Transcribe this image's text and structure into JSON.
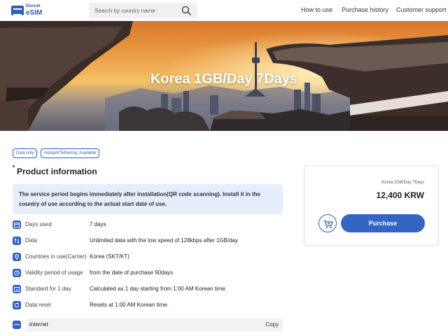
{
  "header": {
    "logo_small": "Doorak",
    "logo_big": "eSIM",
    "search_placeholder": "Search by country name",
    "nav": [
      "How to use",
      "Purchase history",
      "Customer support"
    ]
  },
  "hero": {
    "title": "Korea 1GB/Day 7Days"
  },
  "tags": [
    "Data only",
    "Hotspot/Tethering: Available"
  ],
  "product": {
    "section_title": "Product information",
    "notice": "The service period begins immediately after installation(QR code scanning). Install it in the country of use according to the actual start date of use.",
    "rows": [
      {
        "label": "Days used",
        "value": "7 days",
        "icon": "calendar-icon"
      },
      {
        "label": "Data",
        "value": "Unlimited data with the low speed of 128kbps after 1GB/day",
        "icon": "data-arrows-icon"
      },
      {
        "label": "Countries in use(Carrier)",
        "value": "Korea (SKT/KT)",
        "icon": "location-pin-icon"
      },
      {
        "label": "Validity period of usage",
        "value": "from the date of purchase 90days",
        "icon": "clock-icon"
      },
      {
        "label": "Standard for 1 day",
        "value": "Calculated as 1 day starting from 1:00 AM Korean time.",
        "icon": "calendar-day-icon"
      },
      {
        "label": "Data reset",
        "value": "Resets at 1:00 AM Korean time.",
        "icon": "refresh-icon"
      }
    ],
    "apn": {
      "icon_text": "APN",
      "value": "internet",
      "copy_label": "Copy"
    }
  },
  "purchase": {
    "product_name": "Korea 1GB/Day 7Days",
    "price": "12,400 KRW",
    "button_label": "Purchase"
  },
  "colors": {
    "accent": "#2f5fb8",
    "button": "#3465c4",
    "notice_bg": "#e6eefb"
  }
}
